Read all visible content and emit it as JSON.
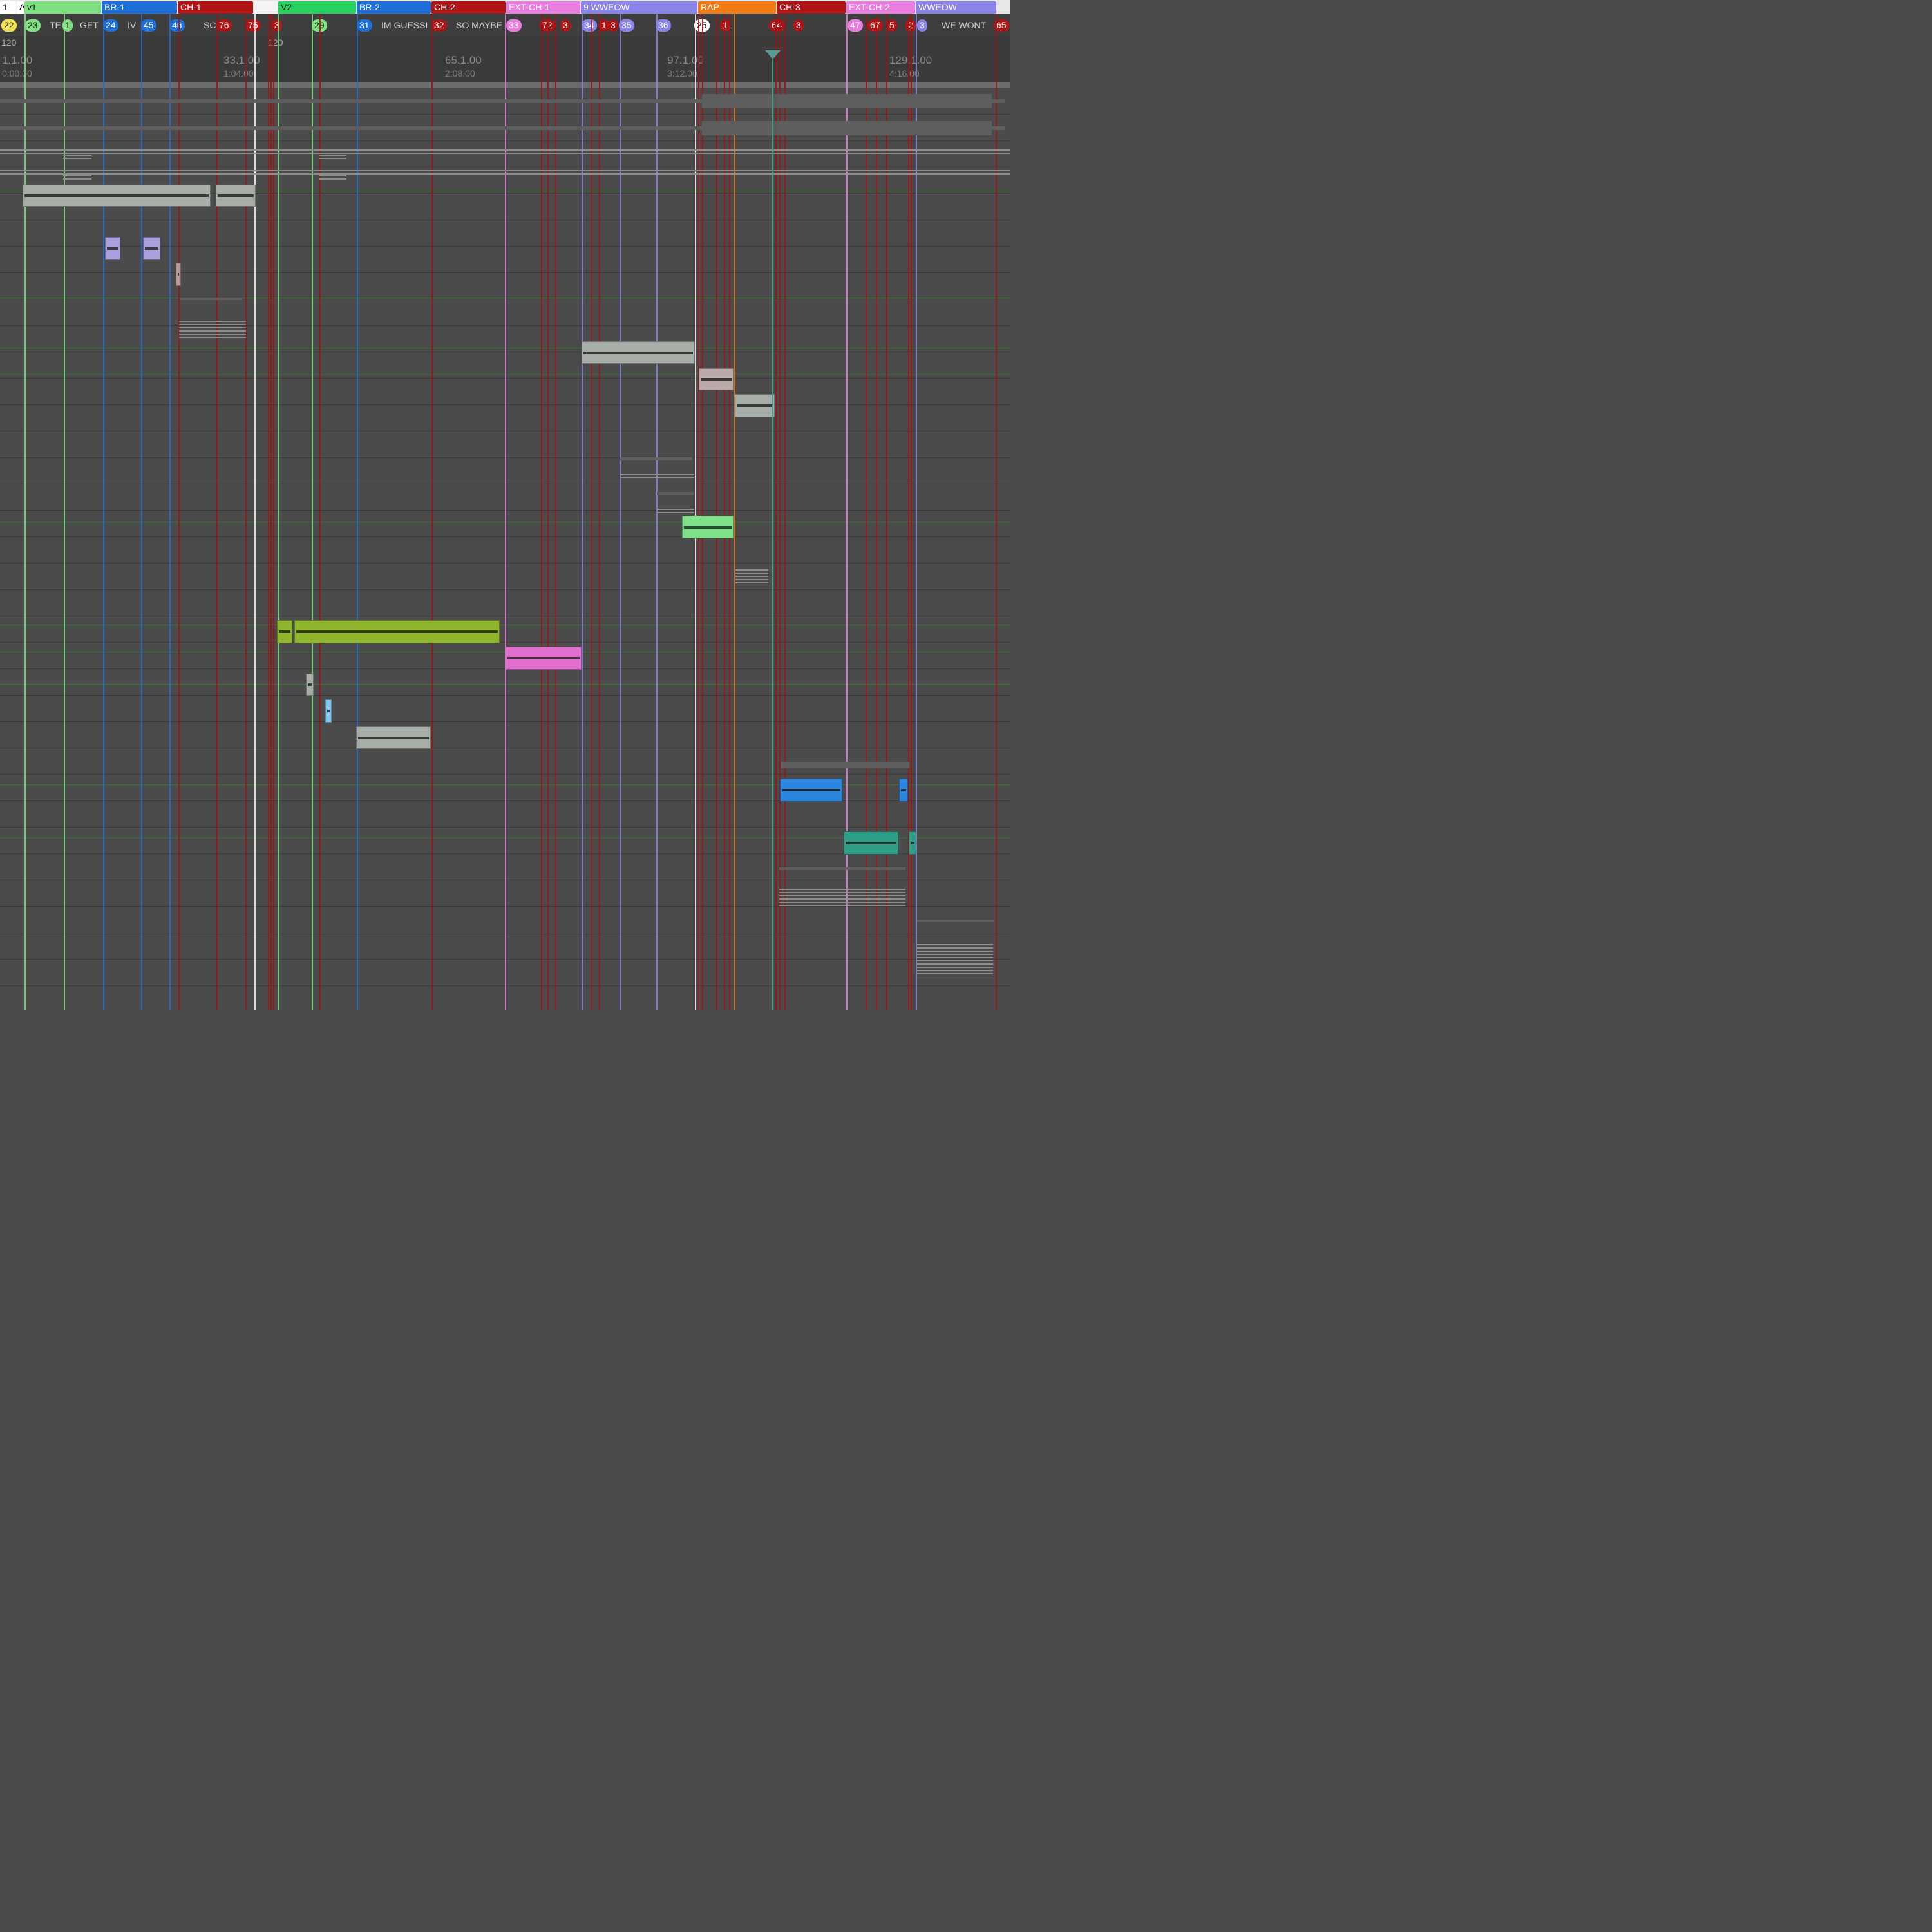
{
  "tempo": {
    "start": "120",
    "change": "120"
  },
  "regions": [
    {
      "label": "1",
      "color": "#ffffff",
      "text": "#000000"
    },
    {
      "label": "A",
      "color": "#ffffff",
      "text": "#000000"
    },
    {
      "label": "v1",
      "color": "#7ee07e",
      "text": "#102010"
    },
    {
      "label": "BR-1",
      "color": "#1e6fd8",
      "text": "#ffffff"
    },
    {
      "label": "CH-1",
      "color": "#b01414",
      "text": "#ffffff"
    },
    {
      "label": "",
      "color": "#f4f4f4",
      "text": "#000000"
    },
    {
      "label": "V2",
      "color": "#28d060",
      "text": "#0b2b0b"
    },
    {
      "label": "BR-2",
      "color": "#1e6fd8",
      "text": "#ffffff"
    },
    {
      "label": "CH-2",
      "color": "#b01414",
      "text": "#ffffff"
    },
    {
      "label": "EXT-CH-1",
      "color": "#e97ee0",
      "text": "#ffffff"
    },
    {
      "label": "9  WWEOW",
      "color": "#8a84e8",
      "text": "#ffffff"
    },
    {
      "label": "RAP",
      "color": "#f07a14",
      "text": "#ffffff"
    },
    {
      "label": "CH-3",
      "color": "#b01414",
      "text": "#ffffff"
    },
    {
      "label": "EXT-CH-2",
      "color": "#e97ee0",
      "text": "#ffffff"
    },
    {
      "label": "WWEOW",
      "color": "#8a84e8",
      "text": "#ffffff"
    }
  ],
  "markers": [
    {
      "label": "22",
      "color": "#f2e24a",
      "text": "#202020"
    },
    {
      "label": "23",
      "color": "#7ee07e",
      "text": "#102010"
    },
    {
      "label": "1",
      "color": "#7ee07e",
      "text": "#102010"
    },
    {
      "label": "24",
      "color": "#1e6fd8",
      "text": "#ffffff"
    },
    {
      "label": "45",
      "color": "#1e6fd8",
      "text": "#ffffff"
    },
    {
      "label": "46",
      "color": "#1e6fd8",
      "text": "#ffffff"
    },
    {
      "label": "76",
      "color": "#b01414",
      "text": "#ffffff"
    },
    {
      "label": "75",
      "color": "#b01414",
      "text": "#ffffff"
    },
    {
      "label": "3",
      "color": "#b01414",
      "text": "#ffffff"
    },
    {
      "label": "29",
      "color": "#7ee07e",
      "text": "#102010"
    },
    {
      "label": "31",
      "color": "#1e6fd8",
      "text": "#ffffff"
    },
    {
      "label": "32",
      "color": "#b01414",
      "text": "#ffffff"
    },
    {
      "label": "33",
      "color": "#e97ee0",
      "text": "#ffffff"
    },
    {
      "label": "72",
      "color": "#b01414",
      "text": "#ffffff"
    },
    {
      "label": "3",
      "color": "#b01414",
      "text": "#ffffff"
    },
    {
      "label": "34",
      "color": "#8a84e8",
      "text": "#ffffff"
    },
    {
      "label": "1",
      "color": "#b01414",
      "text": "#ffffff"
    },
    {
      "label": "3",
      "color": "#b01414",
      "text": "#ffffff"
    },
    {
      "label": "35",
      "color": "#8a84e8",
      "text": "#ffffff"
    },
    {
      "label": "36",
      "color": "#8a84e8",
      "text": "#ffffff"
    },
    {
      "label": "25",
      "color": "#ffffff",
      "text": "#000000"
    },
    {
      "label": "1",
      "color": "#b01414",
      "text": "#ffffff"
    },
    {
      "label": "64",
      "color": "#b01414",
      "text": "#ffffff"
    },
    {
      "label": "3",
      "color": "#b01414",
      "text": "#ffffff"
    },
    {
      "label": "47",
      "color": "#e97ee0",
      "text": "#ffffff"
    },
    {
      "label": "67",
      "color": "#b01414",
      "text": "#ffffff"
    },
    {
      "label": "5",
      "color": "#b01414",
      "text": "#ffffff"
    },
    {
      "label": "2",
      "color": "#b01414",
      "text": "#ffffff"
    },
    {
      "label": "3",
      "color": "#8a84e8",
      "text": "#ffffff"
    },
    {
      "label": "65",
      "color": "#b01414",
      "text": "#ffffff"
    }
  ],
  "marker_texts": [
    "TE",
    "GET",
    "IV",
    "SC",
    "IM GUESSI",
    "SO MAYBE",
    "WE WONT"
  ],
  "ruler": [
    {
      "bar": "1.1.00",
      "time": "0:00.00"
    },
    {
      "bar": "33.1.00",
      "time": "1:04.00"
    },
    {
      "bar": "65.1.00",
      "time": "2:08.00"
    },
    {
      "bar": "97.1.00",
      "time": "3:12.00"
    },
    {
      "bar": "129.1.00",
      "time": "4:16.00"
    }
  ],
  "colors": {
    "green": "#7ee07e",
    "blue": "#1e6fd8",
    "red": "#a31212",
    "pink": "#e97ee0",
    "purple": "#8a84e8",
    "orange": "#f07a14",
    "white": "#f4f4f4",
    "yellow": "#e8e070",
    "clip_gray": "#a7ada7",
    "clip_lavender": "#a9a0dc",
    "clip_lime": "#8fb52c",
    "clip_pink": "#e06fcf",
    "clip_mint": "#7fe08a",
    "clip_blue": "#2a86de",
    "clip_teal": "#2f9e86",
    "clip_lightblue": "#7fc8f0"
  },
  "icons": [
    "playhead-marker-icon"
  ]
}
